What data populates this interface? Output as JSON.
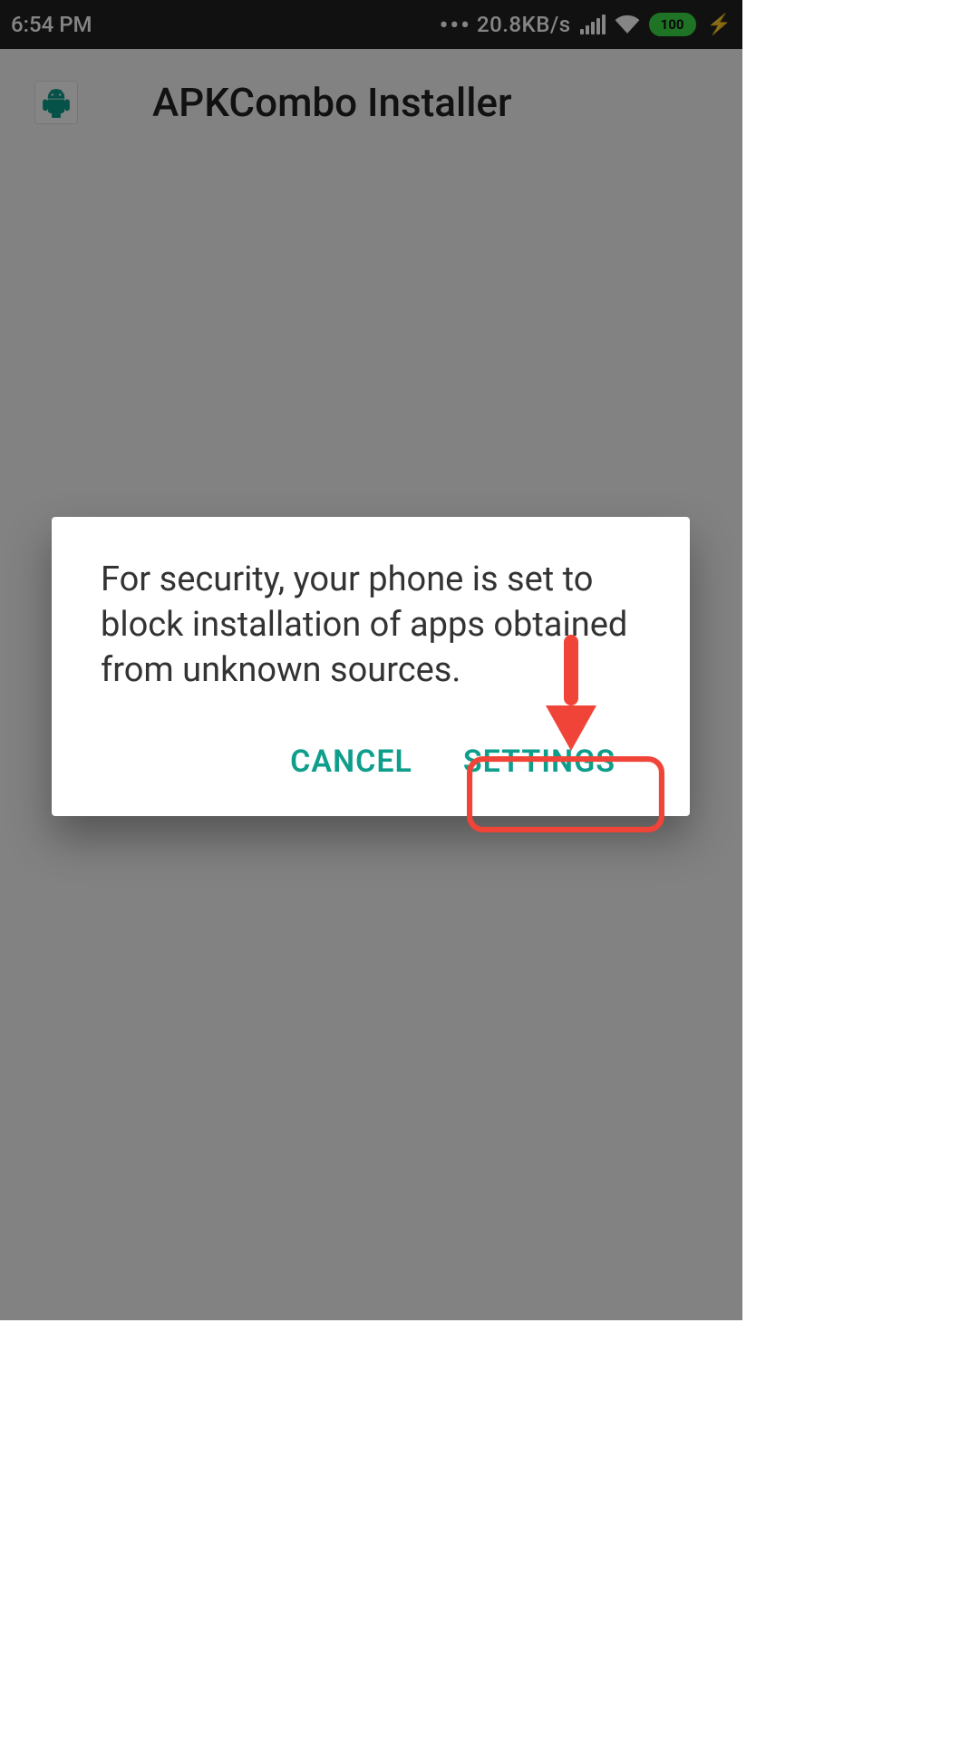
{
  "statusbar": {
    "time": "6:54 PM",
    "net_speed": "20.8KB/s",
    "battery_level": "100",
    "icons": {
      "more": "more-dots-icon",
      "signal": "cellular-signal-icon",
      "wifi": "wifi-icon",
      "battery": "battery-full-icon",
      "charging": "charging-bolt-icon"
    }
  },
  "app": {
    "title": "APKCombo Installer",
    "icon_name": "android-robot-icon"
  },
  "dialog": {
    "message": "For security, your phone is set to block installation of apps obtained from unknown sources.",
    "cancel_label": "CANCEL",
    "settings_label": "SETTINGS"
  },
  "annotation": {
    "arrow_color": "#f04438",
    "highlight_target": "settings-button"
  },
  "colors": {
    "accent_green": "#3ddc47",
    "teal": "#0e9e8b",
    "highlight_red": "#f04438",
    "statusbar_bg": "#222222"
  }
}
